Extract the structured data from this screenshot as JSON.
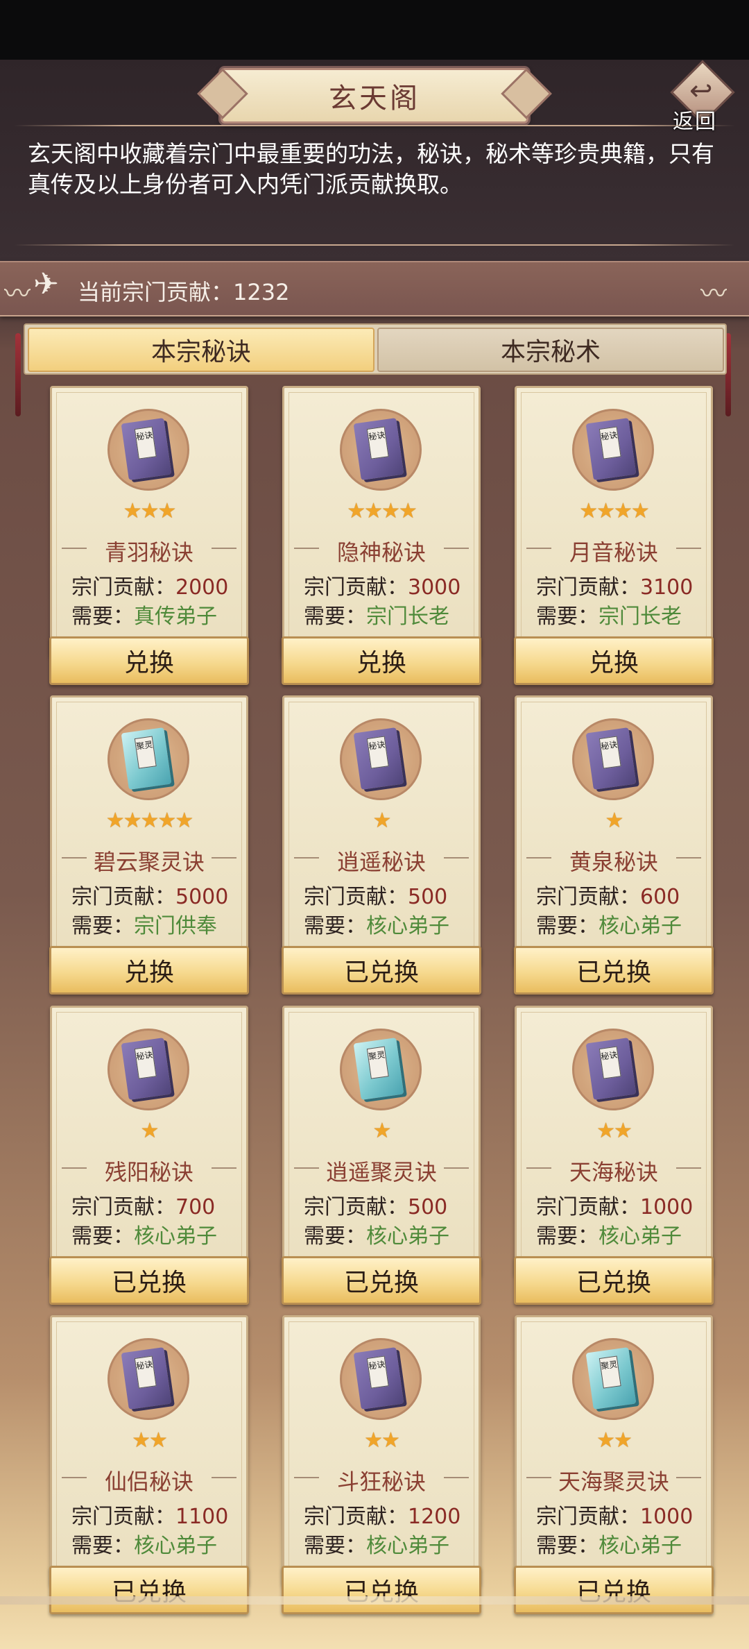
{
  "title": "玄天阁",
  "back_label": "返回",
  "description": "玄天阁中收藏着宗门中最重要的功法，秘诀，秘术等珍贵典籍，只有真传及以上身份者可入内凭门派贡献换取。",
  "contribution_text": "当前宗门贡献：1232",
  "tabs": [
    {
      "label": "本宗秘诀"
    },
    {
      "label": "本宗秘术"
    }
  ],
  "cards": [
    {
      "name": "青羽秘诀",
      "stars": "★★★",
      "contrib_label": "宗门贡献：",
      "contrib": "2000",
      "req_label": "需要：",
      "req": "真传弟子",
      "button": "兑换",
      "book": "purple",
      "book_text": "秘诀"
    },
    {
      "name": "隐神秘诀",
      "stars": "★★★★",
      "contrib_label": "宗门贡献：",
      "contrib": "3000",
      "req_label": "需要：",
      "req": "宗门长老",
      "button": "兑换",
      "book": "purple",
      "book_text": "秘诀"
    },
    {
      "name": "月音秘诀",
      "stars": "★★★★",
      "contrib_label": "宗门贡献：",
      "contrib": "3100",
      "req_label": "需要：",
      "req": "宗门长老",
      "button": "兑换",
      "book": "purple",
      "book_text": "秘诀"
    },
    {
      "name": "碧云聚灵诀",
      "stars": "★★★★★",
      "contrib_label": "宗门贡献：",
      "contrib": "5000",
      "req_label": "需要：",
      "req": "宗门供奉",
      "button": "兑换",
      "book": "jade",
      "book_text": "聚灵"
    },
    {
      "name": "逍遥秘诀",
      "stars": "★",
      "contrib_label": "宗门贡献：",
      "contrib": "500",
      "req_label": "需要：",
      "req": "核心弟子",
      "button": "已兑换",
      "book": "purple",
      "book_text": "秘诀"
    },
    {
      "name": "黄泉秘诀",
      "stars": "★",
      "contrib_label": "宗门贡献：",
      "contrib": "600",
      "req_label": "需要：",
      "req": "核心弟子",
      "button": "已兑换",
      "book": "purple",
      "book_text": "秘诀"
    },
    {
      "name": "残阳秘诀",
      "stars": "★",
      "contrib_label": "宗门贡献：",
      "contrib": "700",
      "req_label": "需要：",
      "req": "核心弟子",
      "button": "已兑换",
      "book": "purple",
      "book_text": "秘诀"
    },
    {
      "name": "逍遥聚灵诀",
      "stars": "★",
      "contrib_label": "宗门贡献：",
      "contrib": "500",
      "req_label": "需要：",
      "req": "核心弟子",
      "button": "已兑换",
      "book": "jade",
      "book_text": "聚灵"
    },
    {
      "name": "天海秘诀",
      "stars": "★★",
      "contrib_label": "宗门贡献：",
      "contrib": "1000",
      "req_label": "需要：",
      "req": "核心弟子",
      "button": "已兑换",
      "book": "purple",
      "book_text": "秘诀"
    },
    {
      "name": "仙侣秘诀",
      "stars": "★★",
      "contrib_label": "宗门贡献：",
      "contrib": "1100",
      "req_label": "需要：",
      "req": "核心弟子",
      "button": "已兑换",
      "book": "purple",
      "book_text": "秘诀"
    },
    {
      "name": "斗狂秘诀",
      "stars": "★★",
      "contrib_label": "宗门贡献：",
      "contrib": "1200",
      "req_label": "需要：",
      "req": "核心弟子",
      "button": "已兑换",
      "book": "purple",
      "book_text": "秘诀"
    },
    {
      "name": "天海聚灵诀",
      "stars": "★★",
      "contrib_label": "宗门贡献：",
      "contrib": "1000",
      "req_label": "需要：",
      "req": "核心弟子",
      "button": "已兑换",
      "book": "jade",
      "book_text": "聚灵"
    }
  ]
}
